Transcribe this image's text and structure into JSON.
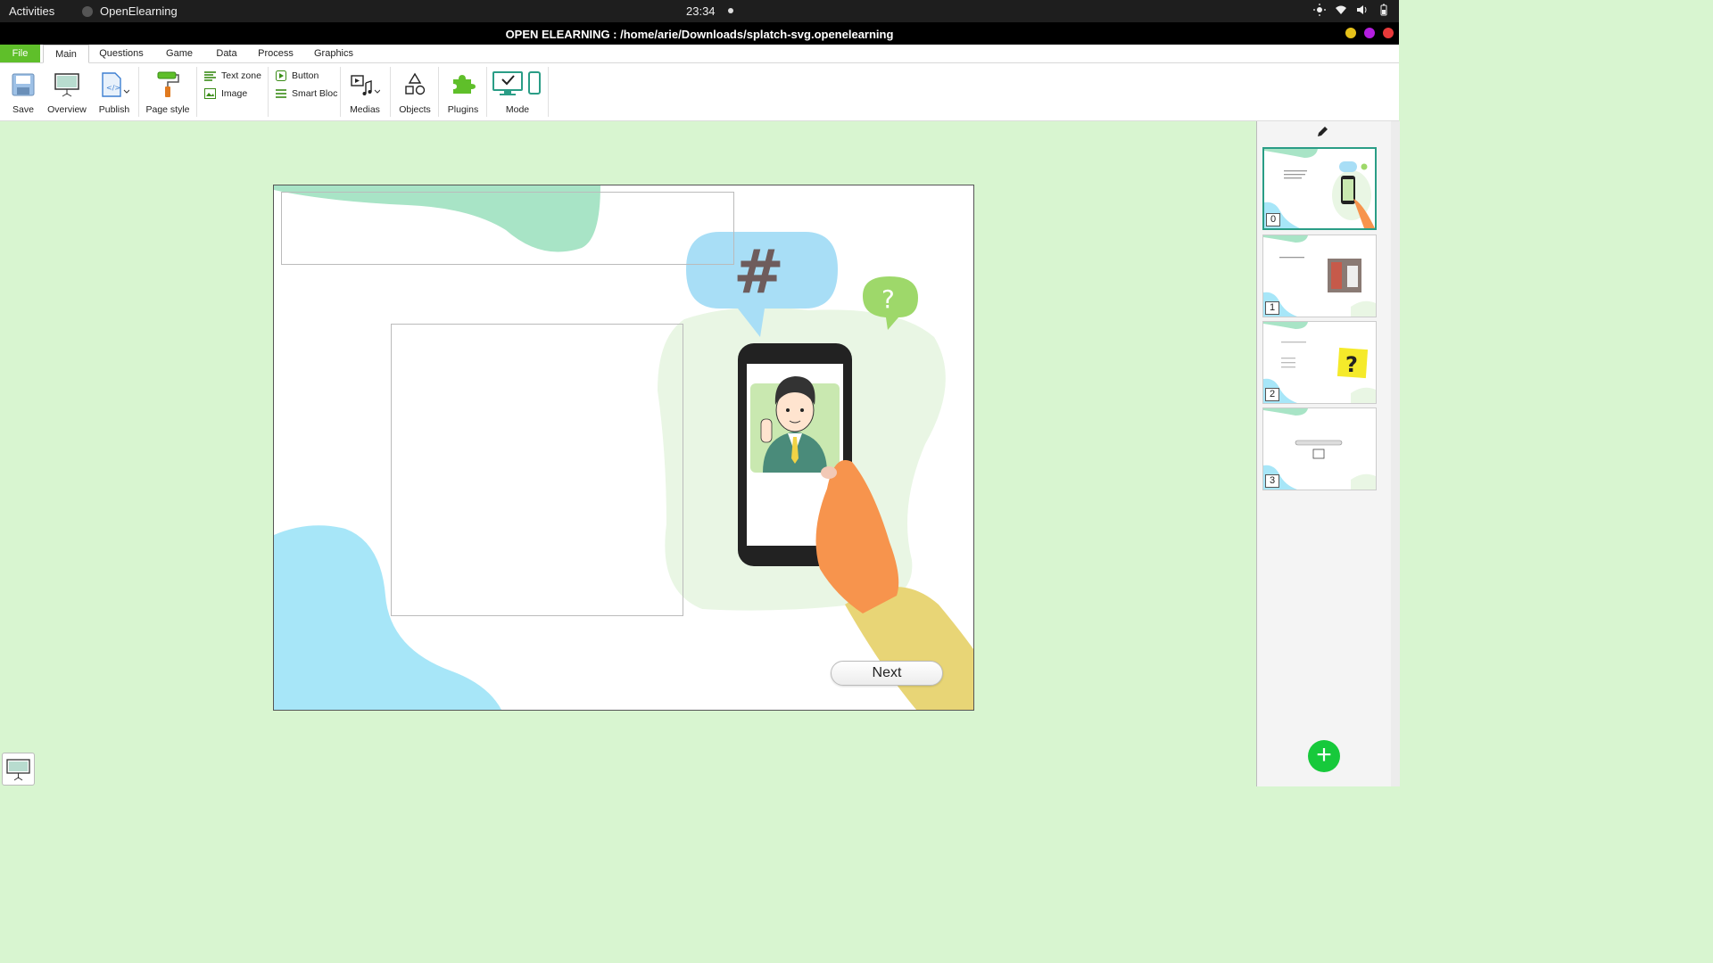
{
  "system_bar": {
    "activities": "Activities",
    "app_name": "OpenElearning",
    "clock": "23:34"
  },
  "window": {
    "title": "OPEN ELEARNING : /home/arie/Downloads/splatch-svg.openelearning",
    "buttons": [
      "#e6c21a",
      "#b41ee0",
      "#e83a3a"
    ]
  },
  "menu": {
    "tabs": [
      "File",
      "Main",
      "Questions",
      "Game",
      "Data",
      "Process",
      "Graphics"
    ],
    "active": "Main"
  },
  "ribbon": {
    "save": "Save",
    "overview": "Overview",
    "publish": "Publish",
    "page_style": "Page style",
    "text_zone": "Text zone",
    "image": "Image",
    "button": "Button",
    "smart_bloc": "Smart Bloc",
    "medias": "Medias",
    "objects": "Objects",
    "plugins": "Plugins",
    "mode": "Mode"
  },
  "canvas": {
    "next_label": "Next",
    "hashtag": "#",
    "question_mark": "?"
  },
  "pages": [
    {
      "num": "0",
      "active": true
    },
    {
      "num": "1",
      "active": false
    },
    {
      "num": "2",
      "active": false
    },
    {
      "num": "3",
      "active": false
    }
  ],
  "colors": {
    "accent_green": "#5fbf2a",
    "add_button": "#17c93b",
    "workspace": "#d8f5d0",
    "active_thumb_border": "#2a9d86"
  }
}
